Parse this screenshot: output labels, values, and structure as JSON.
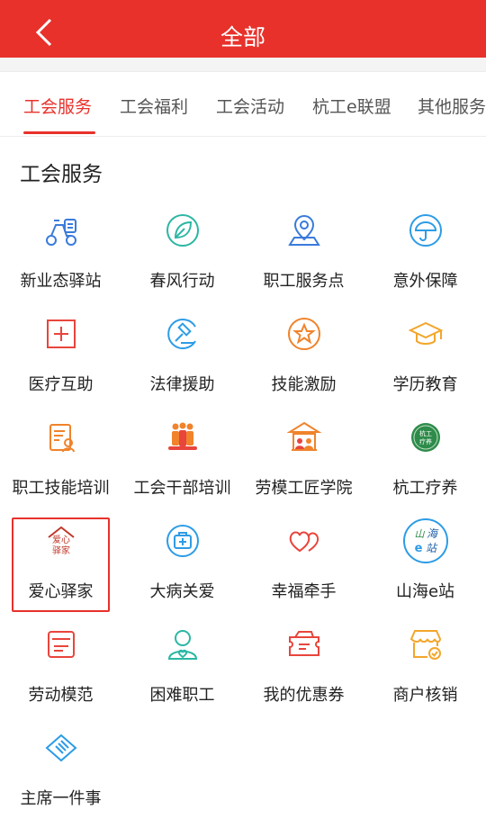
{
  "header": {
    "title": "全部",
    "back_icon": "chevron-left-icon"
  },
  "tabs": [
    {
      "label": "工会服务",
      "active": true
    },
    {
      "label": "工会福利",
      "active": false
    },
    {
      "label": "工会活动",
      "active": false
    },
    {
      "label": "杭工e联盟",
      "active": false
    },
    {
      "label": "其他服务",
      "active": false
    }
  ],
  "section": {
    "title": "工会服务"
  },
  "services": [
    {
      "label": "新业态驿站",
      "icon": "scooter-icon"
    },
    {
      "label": "春风行动",
      "icon": "leaf-icon"
    },
    {
      "label": "职工服务点",
      "icon": "location-pin-icon"
    },
    {
      "label": "意外保障",
      "icon": "umbrella-icon"
    },
    {
      "label": "医疗互助",
      "icon": "medical-cross-icon"
    },
    {
      "label": "法律援助",
      "icon": "gavel-icon"
    },
    {
      "label": "技能激励",
      "icon": "star-badge-icon"
    },
    {
      "label": "学历教育",
      "icon": "graduation-cap-icon"
    },
    {
      "label": "职工技能培训",
      "icon": "training-document-icon"
    },
    {
      "label": "工会干部培训",
      "icon": "group-people-icon"
    },
    {
      "label": "劳模工匠学院",
      "icon": "academy-building-icon"
    },
    {
      "label": "杭工疗养",
      "icon": "recuperation-logo-icon",
      "logo_text": "杭工疗养"
    },
    {
      "label": "爱心驿家",
      "icon": "love-home-logo-icon",
      "logo_text": "爱心驿家",
      "highlighted": true
    },
    {
      "label": "大病关爱",
      "icon": "medical-kit-icon"
    },
    {
      "label": "幸福牵手",
      "icon": "two-hearts-icon"
    },
    {
      "label": "山海e站",
      "icon": "shanhai-logo-icon",
      "logo_text": "山海e站"
    },
    {
      "label": "劳动模范",
      "icon": "model-worker-card-icon"
    },
    {
      "label": "困难职工",
      "icon": "care-person-icon"
    },
    {
      "label": "我的优惠券",
      "icon": "coupon-icon"
    },
    {
      "label": "商户核销",
      "icon": "store-verify-icon"
    },
    {
      "label": "主席一件事",
      "icon": "handshake-icon"
    }
  ],
  "colors": {
    "brand_red": "#e8312b",
    "teal": "#2bb7a3",
    "blue": "#3a7bdc",
    "orange": "#f39a2b",
    "red_icon": "#e8453c",
    "sky": "#2d9ce6"
  }
}
